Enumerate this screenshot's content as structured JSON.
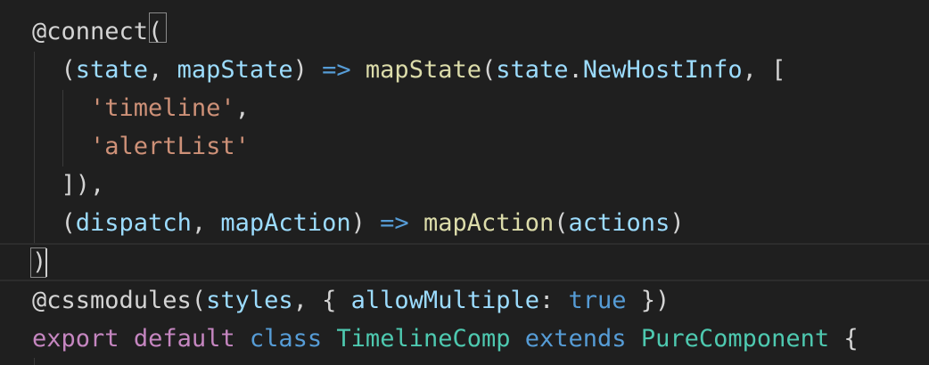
{
  "editor": {
    "lines": [
      {
        "tokens": [
          {
            "text": "@connect(",
            "role": "plain"
          }
        ]
      },
      {
        "tokens": [
          {
            "text": "  (",
            "role": "plain"
          },
          {
            "text": "state",
            "role": "param"
          },
          {
            "text": ", ",
            "role": "plain"
          },
          {
            "text": "mapState",
            "role": "param"
          },
          {
            "text": ") ",
            "role": "plain"
          },
          {
            "text": "=>",
            "role": "kw"
          },
          {
            "text": " ",
            "role": "plain"
          },
          {
            "text": "mapState",
            "role": "fn"
          },
          {
            "text": "(",
            "role": "plain"
          },
          {
            "text": "state",
            "role": "param"
          },
          {
            "text": ".",
            "role": "plain"
          },
          {
            "text": "NewHostInfo",
            "role": "param"
          },
          {
            "text": ", [",
            "role": "plain"
          }
        ]
      },
      {
        "tokens": [
          {
            "text": "    ",
            "role": "plain"
          },
          {
            "text": "'timeline'",
            "role": "str"
          },
          {
            "text": ",",
            "role": "plain"
          }
        ]
      },
      {
        "tokens": [
          {
            "text": "    ",
            "role": "plain"
          },
          {
            "text": "'alertList'",
            "role": "str"
          }
        ]
      },
      {
        "tokens": [
          {
            "text": "  ]),",
            "role": "plain"
          }
        ]
      },
      {
        "tokens": [
          {
            "text": "  (",
            "role": "plain"
          },
          {
            "text": "dispatch",
            "role": "param"
          },
          {
            "text": ", ",
            "role": "plain"
          },
          {
            "text": "mapAction",
            "role": "param"
          },
          {
            "text": ") ",
            "role": "plain"
          },
          {
            "text": "=>",
            "role": "kw"
          },
          {
            "text": " ",
            "role": "plain"
          },
          {
            "text": "mapAction",
            "role": "fn"
          },
          {
            "text": "(",
            "role": "plain"
          },
          {
            "text": "actions",
            "role": "param"
          },
          {
            "text": ")",
            "role": "plain"
          }
        ]
      },
      {
        "tokens": [
          {
            "text": ")",
            "role": "plain"
          }
        ]
      },
      {
        "tokens": [
          {
            "text": "@cssmodules(",
            "role": "plain"
          },
          {
            "text": "styles",
            "role": "param"
          },
          {
            "text": ", { ",
            "role": "plain"
          },
          {
            "text": "allowMultiple",
            "role": "param"
          },
          {
            "text": ": ",
            "role": "plain"
          },
          {
            "text": "true",
            "role": "kw"
          },
          {
            "text": " })",
            "role": "plain"
          }
        ]
      },
      {
        "tokens": [
          {
            "text": "export",
            "role": "ctrl"
          },
          {
            "text": " ",
            "role": "plain"
          },
          {
            "text": "default",
            "role": "ctrl"
          },
          {
            "text": " ",
            "role": "plain"
          },
          {
            "text": "class",
            "role": "kw"
          },
          {
            "text": " ",
            "role": "plain"
          },
          {
            "text": "TimelineComp",
            "role": "type"
          },
          {
            "text": " ",
            "role": "plain"
          },
          {
            "text": "extends",
            "role": "kw"
          },
          {
            "text": " ",
            "role": "plain"
          },
          {
            "text": "PureComponent",
            "role": "type"
          },
          {
            "text": " {",
            "role": "plain"
          }
        ]
      }
    ]
  },
  "theme": {
    "background": "#1f1f1f",
    "plain": "#d4d4d4",
    "param": "#9cdcfe",
    "function": "#dcdcaa",
    "keyword": "#569cd6",
    "string": "#ce9178",
    "control": "#c586c0",
    "type": "#4ec9b0"
  }
}
